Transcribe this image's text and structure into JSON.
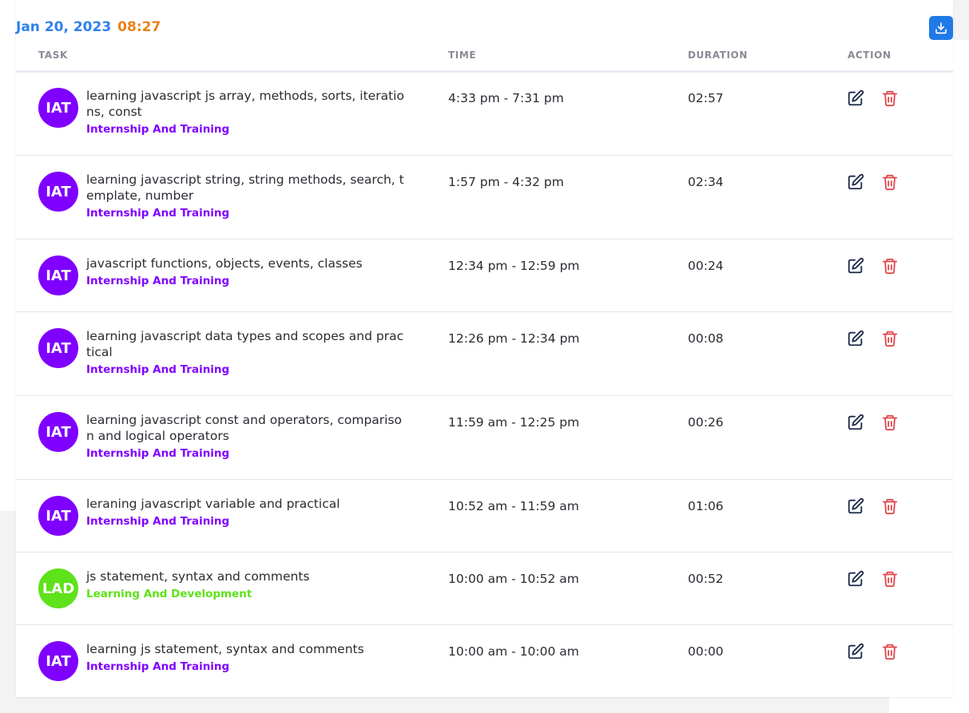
{
  "header": {
    "date": "Jan 20, 2023",
    "clock": "08:27",
    "download_icon": "download-icon"
  },
  "table": {
    "columns": [
      "TASK",
      "TIME",
      "DURATION",
      "ACTION"
    ],
    "rows": [
      {
        "avatar": "IAT",
        "title": "learning javascript js array, methods, sorts, iterations, const",
        "category": "Internship And Training",
        "time": "4:33 pm - 7:31 pm",
        "duration": "02:57"
      },
      {
        "avatar": "IAT",
        "title": "learning javascript string, string methods, search, template, number",
        "category": "Internship And Training",
        "time": "1:57 pm - 4:32 pm",
        "duration": "02:34"
      },
      {
        "avatar": "IAT",
        "title": "javascript functions, objects, events, classes",
        "category": "Internship And Training",
        "time": "12:34 pm - 12:59 pm",
        "duration": "00:24"
      },
      {
        "avatar": "IAT",
        "title": "learning javascript data types and scopes and practical",
        "category": "Internship And Training",
        "time": "12:26 pm - 12:34 pm",
        "duration": "00:08"
      },
      {
        "avatar": "IAT",
        "title": "learning javascript const and operators, comparison and logical operators",
        "category": "Internship And Training",
        "time": "11:59 am - 12:25 pm",
        "duration": "00:26"
      },
      {
        "avatar": "IAT",
        "title": "leraning javascript variable and practical",
        "category": "Internship And Training",
        "time": "10:52 am - 11:59 am",
        "duration": "01:06"
      },
      {
        "avatar": "LAD",
        "title": "js statement, syntax and comments",
        "category": "Learning And Development",
        "time": "10:00 am - 10:52 am",
        "duration": "00:52"
      },
      {
        "avatar": "IAT",
        "title": "learning js statement, syntax and comments",
        "category": "Internship And Training",
        "time": "10:00 am - 10:00 am",
        "duration": "00:00"
      }
    ],
    "actions": {
      "edit_icon": "edit-icon",
      "delete_icon": "trash-icon"
    }
  },
  "colors": {
    "date": "#2f80ed",
    "clock": "#e8821a",
    "iat": "#7f00ff",
    "lad": "#5ee21a",
    "edit": "#1e2a4a",
    "delete": "#e0474c",
    "download_button": "#1f7ae6"
  }
}
